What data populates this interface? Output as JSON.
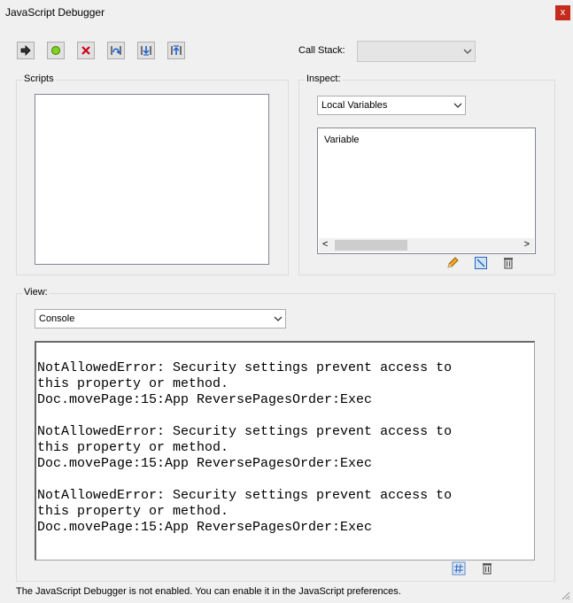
{
  "window": {
    "title": "JavaScript Debugger",
    "close_label": "x"
  },
  "toolbar": [
    {
      "icon": "resume-icon"
    },
    {
      "icon": "interrupt-icon"
    },
    {
      "icon": "quit-icon"
    },
    {
      "icon": "step-over-icon"
    },
    {
      "icon": "step-into-icon"
    },
    {
      "icon": "step-out-icon"
    }
  ],
  "call_stack": {
    "label": "Call Stack:",
    "value": ""
  },
  "scripts": {
    "label": "Scripts"
  },
  "inspect": {
    "label": "Inspect:",
    "selected": "Local Variables",
    "column_header": "Variable",
    "scroll_left": "<",
    "scroll_right": ">"
  },
  "view": {
    "label": "View:",
    "selected": "Console",
    "console_text": "NotAllowedError: Security settings prevent access to\nthis property or method.\nDoc.movePage:15:App ReversePagesOrder:Exec\n\nNotAllowedError: Security settings prevent access to\nthis property or method.\nDoc.movePage:15:App ReversePagesOrder:Exec\n\nNotAllowedError: Security settings prevent access to\nthis property or method.\nDoc.movePage:15:App ReversePagesOrder:Exec"
  },
  "status": {
    "message": "The JavaScript Debugger is not enabled. You can enable it in the JavaScript preferences."
  }
}
